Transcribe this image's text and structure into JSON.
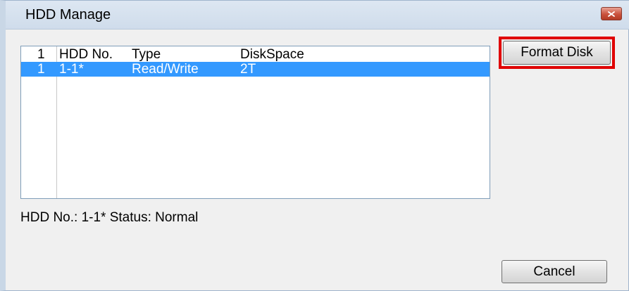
{
  "window": {
    "title": "HDD Manage",
    "close_icon": "close-icon"
  },
  "list": {
    "columns": [
      "1",
      "HDD No.",
      "Type",
      "DiskSpace"
    ],
    "rows": [
      {
        "index": "1",
        "hdd_no": "1-1*",
        "type": "Read/Write",
        "disk_space": "2T",
        "selected": true
      }
    ]
  },
  "status": {
    "text": "HDD No.: 1-1* Status: Normal"
  },
  "buttons": {
    "format_label": "Format Disk",
    "cancel_label": "Cancel"
  },
  "colors": {
    "selection": "#3399ff",
    "highlight_box": "#e00000"
  }
}
